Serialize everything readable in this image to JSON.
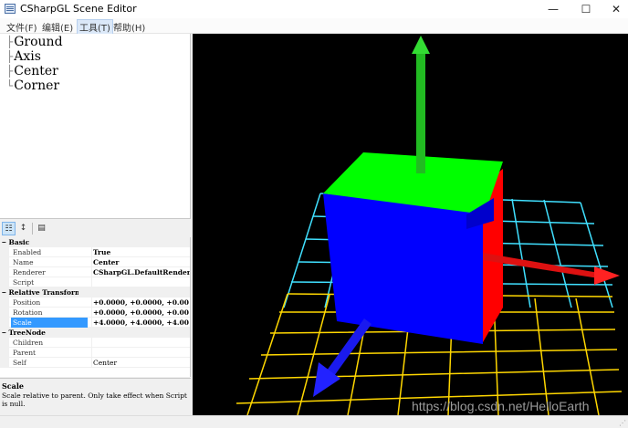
{
  "window": {
    "title": "CSharpGL Scene Editor",
    "minimize_glyph": "—",
    "maximize_glyph": "☐",
    "close_glyph": "✕"
  },
  "menu": {
    "items": [
      {
        "label": "文件(F)"
      },
      {
        "label": "编辑(E)"
      },
      {
        "label": "工具(T)"
      },
      {
        "label": "帮助(H)"
      }
    ]
  },
  "tree": {
    "items": [
      {
        "label": "Ground"
      },
      {
        "label": "Axis"
      },
      {
        "label": "Center"
      },
      {
        "label": "Corner"
      }
    ]
  },
  "property_grid": {
    "toolbar": {
      "categorized_icon": "categorized-icon",
      "alphabetical_icon": "alphabetical-icon",
      "property_pages_icon": "property-pages-icon"
    },
    "rows": [
      {
        "category": "Basic"
      },
      {
        "name": "Enabled",
        "value": "True"
      },
      {
        "name": "Name",
        "value": "Center"
      },
      {
        "name": "Renderer",
        "value": "CSharpGL.DefaultRendere"
      },
      {
        "name": "Script",
        "value": ""
      },
      {
        "category": "Relative Transform"
      },
      {
        "name": "Position",
        "value": "+0.0000, +0.0000, +0.00"
      },
      {
        "name": "Rotation",
        "value": "+0.0000, +0.0000, +0.00"
      },
      {
        "name": "Scale",
        "value": "+4.0000, +4.0000, +4.00"
      },
      {
        "category": "TreeNode"
      },
      {
        "name": "Children",
        "value": ""
      },
      {
        "name": "Parent",
        "value": ""
      },
      {
        "name": "Self",
        "value": "Center"
      }
    ],
    "selected": "Scale"
  },
  "description": {
    "title": "Scale",
    "text": "Scale relative to parent. Only take effect when Script is null."
  },
  "viewport": {
    "watermark": "https://blog.csdn.net/HelloEarth",
    "colors": {
      "background": "#000000",
      "cube_front": "#0000ff",
      "cube_top": "#00ff00",
      "cube_side": "#ff0000",
      "grid_near": "#ffd700",
      "grid_far": "#40e0ff"
    }
  }
}
